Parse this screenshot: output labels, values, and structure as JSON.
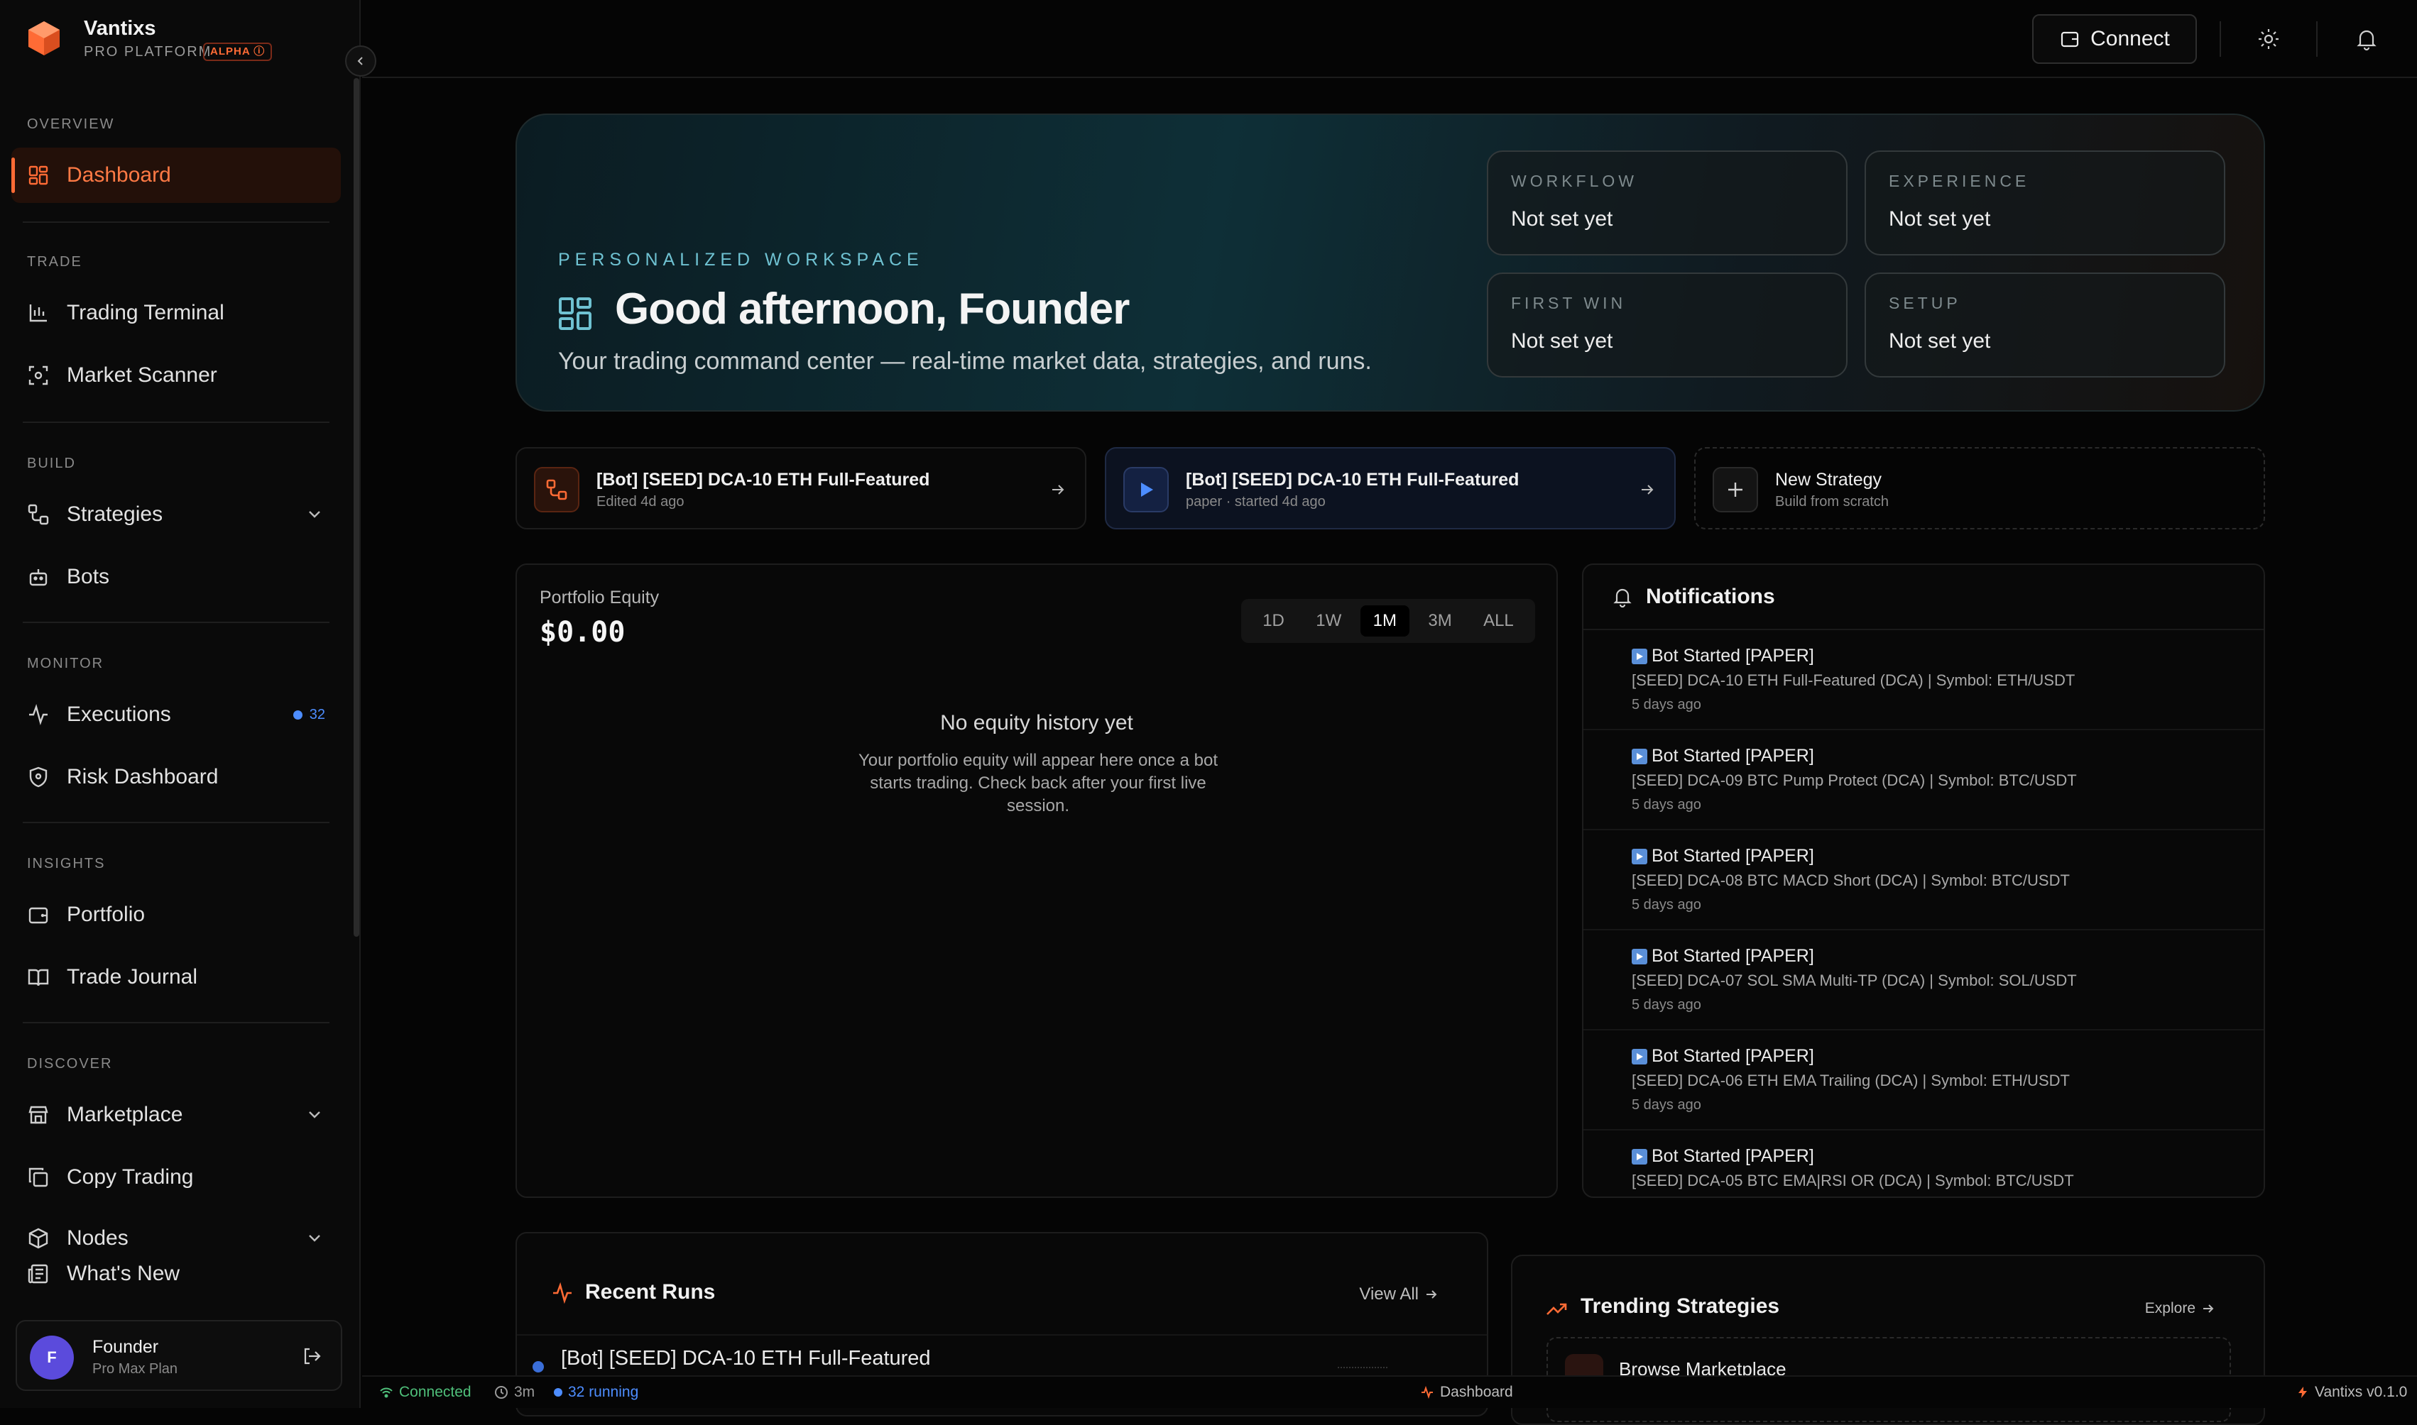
{
  "app": {
    "name": "Vantixs",
    "subtitle": "PRO PLATFORM",
    "badge": "ALPHA",
    "accent_color": "#ff6b35"
  },
  "sidebar": {
    "sections": [
      {
        "label": "OVERVIEW",
        "items": [
          {
            "label": "Dashboard",
            "icon": "grid-icon",
            "active": true
          }
        ]
      },
      {
        "label": "TRADE",
        "items": [
          {
            "label": "Trading Terminal",
            "icon": "chart-bars-icon"
          },
          {
            "label": "Market Scanner",
            "icon": "scan-icon"
          }
        ]
      },
      {
        "label": "BUILD",
        "items": [
          {
            "label": "Strategies",
            "icon": "workflow-icon",
            "expandable": true
          },
          {
            "label": "Bots",
            "icon": "bot-icon"
          }
        ]
      },
      {
        "label": "MONITOR",
        "items": [
          {
            "label": "Executions",
            "icon": "activity-icon",
            "badge": "32"
          },
          {
            "label": "Risk Dashboard",
            "icon": "shield-icon"
          }
        ]
      },
      {
        "label": "INSIGHTS",
        "items": [
          {
            "label": "Portfolio",
            "icon": "wallet-icon"
          },
          {
            "label": "Trade Journal",
            "icon": "book-icon"
          }
        ]
      },
      {
        "label": "DISCOVER",
        "items": [
          {
            "label": "Marketplace",
            "icon": "store-icon",
            "expandable": true
          },
          {
            "label": "Copy Trading",
            "icon": "copy-icon"
          },
          {
            "label": "Nodes",
            "icon": "cube-icon",
            "expandable": true
          },
          {
            "label": "What's New",
            "icon": "newspaper-icon"
          }
        ]
      }
    ],
    "user": {
      "initial": "F",
      "name": "Founder",
      "plan": "Pro Max Plan"
    }
  },
  "topbar": {
    "connect_label": "Connect"
  },
  "hero": {
    "kicker": "PERSONALIZED WORKSPACE",
    "title": "Good afternoon, Founder",
    "subtitle": "Your trading command center — real-time market data, strategies, and runs.",
    "stats": [
      {
        "label": "WORKFLOW",
        "value": "Not set yet"
      },
      {
        "label": "EXPERIENCE",
        "value": "Not set yet"
      },
      {
        "label": "FIRST WIN",
        "value": "Not set yet"
      },
      {
        "label": "SETUP",
        "value": "Not set yet"
      }
    ]
  },
  "quick_actions": [
    {
      "title": "[Bot] [SEED] DCA-10 ETH Full-Featured",
      "sub": "Edited 4d ago"
    },
    {
      "title": "[Bot] [SEED] DCA-10 ETH Full-Featured",
      "sub": "paper · started 4d ago"
    },
    {
      "title": "New Strategy",
      "sub": "Build from scratch"
    }
  ],
  "equity": {
    "label": "Portfolio Equity",
    "value": "$0.00",
    "ranges": [
      "1D",
      "1W",
      "1M",
      "3M",
      "ALL"
    ],
    "active_range": "1M",
    "empty_title": "No equity history yet",
    "empty_desc": "Your portfolio equity will appear here once a bot starts trading. Check back after your first live session."
  },
  "notifications": {
    "title": "Notifications",
    "items": [
      {
        "title": "Bot Started [PAPER]",
        "body": "[SEED] DCA-10 ETH Full-Featured (DCA) | Symbol: ETH/USDT",
        "time": "5 days ago"
      },
      {
        "title": "Bot Started [PAPER]",
        "body": "[SEED] DCA-09 BTC Pump Protect (DCA) | Symbol: BTC/USDT",
        "time": "5 days ago"
      },
      {
        "title": "Bot Started [PAPER]",
        "body": "[SEED] DCA-08 BTC MACD Short (DCA) | Symbol: BTC/USDT",
        "time": "5 days ago"
      },
      {
        "title": "Bot Started [PAPER]",
        "body": "[SEED] DCA-07 SOL SMA Multi-TP (DCA) | Symbol: SOL/USDT",
        "time": "5 days ago"
      },
      {
        "title": "Bot Started [PAPER]",
        "body": "[SEED] DCA-06 ETH EMA Trailing (DCA) | Symbol: ETH/USDT",
        "time": "5 days ago"
      },
      {
        "title": "Bot Started [PAPER]",
        "body": "[SEED] DCA-05 BTC EMA|RSI OR (DCA) | Symbol: BTC/USDT",
        "time": ""
      }
    ]
  },
  "recent_runs": {
    "title": "Recent Runs",
    "view_all": "View All",
    "items": [
      {
        "title": "[Bot] [SEED] DCA-10 ETH Full-Featured"
      }
    ]
  },
  "trending": {
    "title": "Trending Strategies",
    "explore": "Explore",
    "browse": "Browse Marketplace"
  },
  "statusbar": {
    "connection": "Connected",
    "uptime": "3m",
    "running": "32 running",
    "page": "Dashboard",
    "version": "Vantixs v0.1.0"
  }
}
